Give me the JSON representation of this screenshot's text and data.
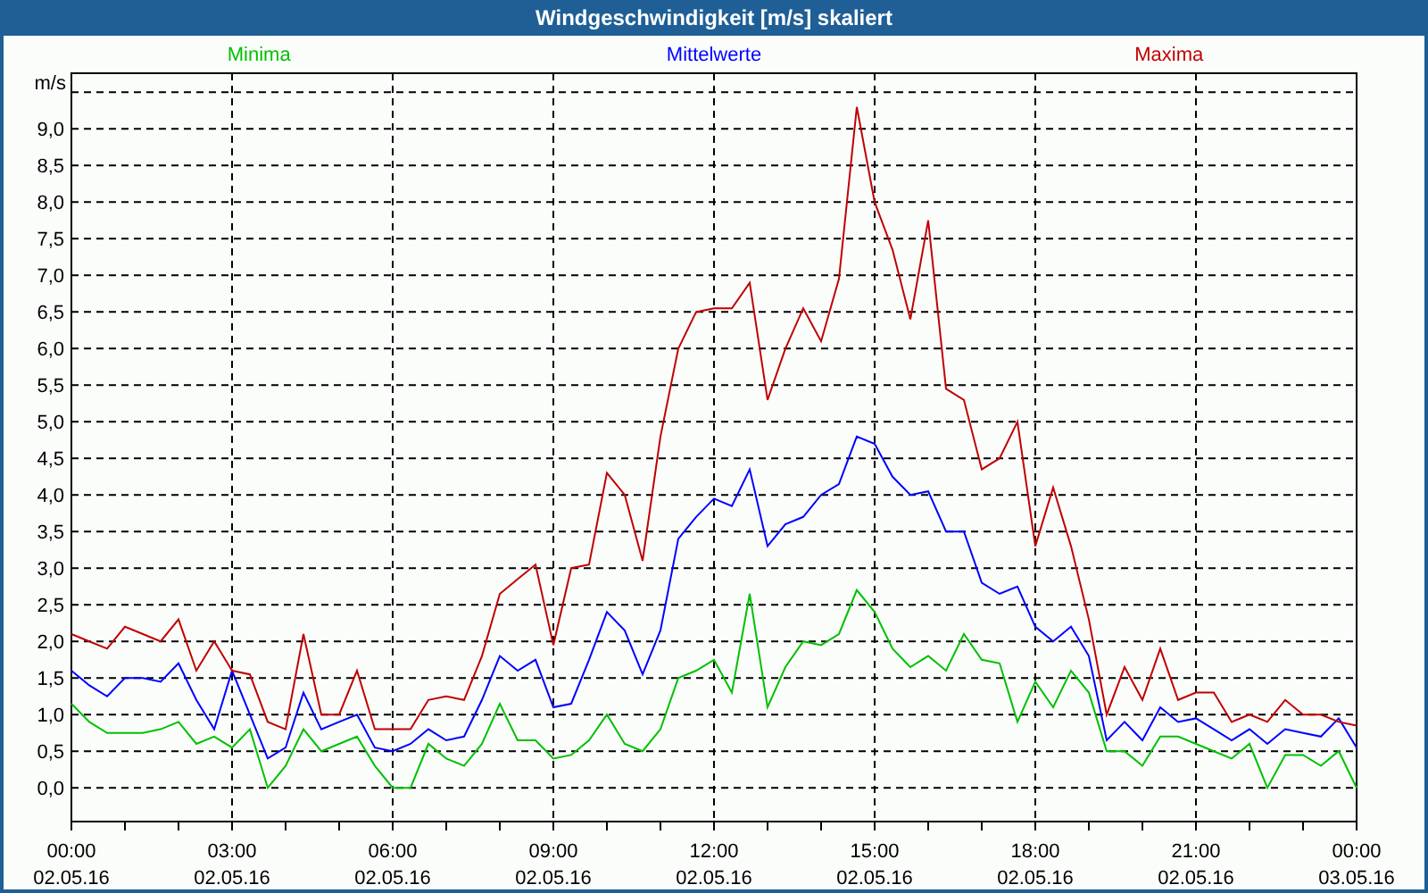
{
  "window": {
    "title": "Windgeschwindigkeit [m/s] skaliert"
  },
  "chart": {
    "chart_data": {
      "type": "line",
      "ylabel": "m/s",
      "grid": true,
      "categories": [
        "00:00 02.05.16",
        null,
        null,
        null,
        null,
        null,
        null,
        null,
        null,
        "03:00 02.05.16",
        null,
        null,
        null,
        null,
        null,
        null,
        null,
        null,
        "06:00 02.05.16",
        null,
        null,
        null,
        null,
        null,
        null,
        null,
        null,
        "09:00 02.05.16",
        null,
        null,
        null,
        null,
        null,
        null,
        null,
        null,
        "12:00 02.05.16",
        null,
        null,
        null,
        null,
        null,
        null,
        null,
        null,
        "15:00 02.05.16",
        null,
        null,
        null,
        null,
        null,
        null,
        null,
        null,
        "18:00 02.05.16",
        null,
        null,
        null,
        null,
        null,
        null,
        null,
        null,
        "21:00 02.05.16",
        null,
        null,
        null,
        null,
        null,
        null,
        null,
        null,
        "00:00 03.05.16"
      ],
      "series": [
        {
          "name": "Minima",
          "color": "#00c000",
          "values": [
            1.15,
            0.9,
            0.75,
            0.75,
            0.75,
            0.8,
            0.9,
            0.6,
            0.7,
            0.55,
            0.8,
            0.0,
            0.3,
            0.8,
            0.5,
            0.6,
            0.7,
            0.3,
            0.0,
            0.0,
            0.6,
            0.4,
            0.3,
            0.6,
            1.15,
            0.65,
            0.65,
            0.4,
            0.45,
            0.65,
            1.0,
            0.6,
            0.5,
            0.8,
            1.5,
            1.6,
            1.75,
            1.3,
            2.65,
            1.1,
            1.65,
            2.0,
            1.95,
            2.1,
            2.7,
            2.4,
            1.9,
            1.65,
            1.8,
            1.6,
            2.1,
            1.75,
            1.7,
            0.9,
            1.45,
            1.1,
            1.6,
            1.3,
            0.5,
            0.5,
            0.3,
            0.7,
            0.7,
            0.6,
            0.5,
            0.4,
            0.6,
            0.0,
            0.45,
            0.45,
            0.3,
            0.5,
            0.0
          ]
        },
        {
          "name": "Mittelwerte",
          "color": "#0000ff",
          "values": [
            1.6,
            1.4,
            1.25,
            1.5,
            1.5,
            1.45,
            1.7,
            1.2,
            0.8,
            1.6,
            1.0,
            0.4,
            0.55,
            1.3,
            0.8,
            0.9,
            1.0,
            0.55,
            0.5,
            0.6,
            0.8,
            0.65,
            0.7,
            1.2,
            1.8,
            1.6,
            1.75,
            1.1,
            1.15,
            1.75,
            2.4,
            2.15,
            1.55,
            2.15,
            3.4,
            3.7,
            3.95,
            3.85,
            4.35,
            3.3,
            3.6,
            3.7,
            4.0,
            4.15,
            4.8,
            4.7,
            4.25,
            4.0,
            4.05,
            3.5,
            3.5,
            2.8,
            2.65,
            2.75,
            2.2,
            2.0,
            2.2,
            1.8,
            0.65,
            0.9,
            0.65,
            1.1,
            0.9,
            0.95,
            0.8,
            0.65,
            0.8,
            0.6,
            0.8,
            0.75,
            0.7,
            0.95,
            0.55
          ]
        },
        {
          "name": "Maxima",
          "color": "#c00000",
          "values": [
            2.1,
            2.0,
            1.9,
            2.2,
            2.1,
            2.0,
            2.3,
            1.6,
            2.0,
            1.6,
            1.55,
            0.9,
            0.8,
            2.1,
            1.0,
            1.0,
            1.6,
            0.8,
            0.8,
            0.8,
            1.2,
            1.25,
            1.2,
            1.8,
            2.65,
            2.85,
            3.05,
            1.95,
            3.0,
            3.05,
            4.3,
            4.0,
            3.1,
            4.8,
            6.0,
            6.5,
            6.55,
            6.55,
            6.9,
            5.3,
            6.0,
            6.55,
            6.1,
            6.95,
            9.3,
            8.0,
            7.35,
            6.4,
            7.75,
            5.45,
            5.3,
            4.35,
            4.5,
            5.0,
            3.3,
            4.1,
            3.3,
            2.3,
            1.0,
            1.65,
            1.2,
            1.9,
            1.2,
            1.3,
            1.3,
            0.9,
            1.0,
            0.9,
            1.2,
            1.0,
            1.0,
            0.9,
            0.85
          ]
        }
      ],
      "ylim": [
        -0.46,
        9.76
      ],
      "yticks": [
        {
          "value": 0,
          "label": "0,0"
        },
        {
          "value": 0.5,
          "label": "0,5"
        },
        {
          "value": 1,
          "label": "1,0"
        },
        {
          "value": 1.5,
          "label": "1,5"
        },
        {
          "value": 2,
          "label": "2,0"
        },
        {
          "value": 2.5,
          "label": "2,5"
        },
        {
          "value": 3,
          "label": "3,0"
        },
        {
          "value": 3.5,
          "label": "3,5"
        },
        {
          "value": 4,
          "label": "4,0"
        },
        {
          "value": 4.5,
          "label": "4,5"
        },
        {
          "value": 5,
          "label": "5,0"
        },
        {
          "value": 5.5,
          "label": "5,5"
        },
        {
          "value": 6,
          "label": "6,0"
        },
        {
          "value": 6.5,
          "label": "6,5"
        },
        {
          "value": 7,
          "label": "7,0"
        },
        {
          "value": 7.5,
          "label": "7,5"
        },
        {
          "value": 8,
          "label": "8,0"
        },
        {
          "value": 8.5,
          "label": "8,5"
        },
        {
          "value": 9,
          "label": "9,0"
        }
      ]
    }
  }
}
